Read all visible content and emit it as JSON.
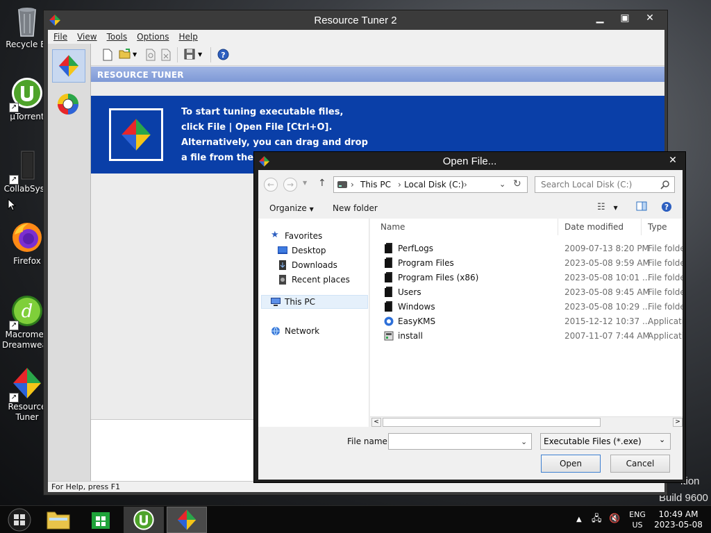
{
  "desktop": {
    "icons": [
      {
        "label": "Recycle Bi",
        "icon": "recycle-bin-icon"
      },
      {
        "label": "µTorrent",
        "icon": "utorrent-icon"
      },
      {
        "label": "CollabSysC",
        "icon": "collabsys-icon"
      },
      {
        "label": "Firefox",
        "icon": "firefox-icon"
      },
      {
        "label": "Macromed",
        "label2": "Dreamweav",
        "icon": "dreamweaver-icon"
      },
      {
        "label": "Resource",
        "label2": "Tuner",
        "icon": "resource-tuner-icon"
      }
    ],
    "edition_text": "ition",
    "build_text": "Build 9600"
  },
  "main_window": {
    "title": "Resource Tuner 2",
    "menu": [
      "File",
      "View",
      "Tools",
      "Options",
      "Help"
    ],
    "header": "RESOURCE TUNER",
    "banner_lines": [
      "To start tuning executable files,",
      "click File | Open File [Ctrl+O].",
      "Alternatively, you can drag and drop",
      "a file from the W"
    ],
    "status": "For Help, press F1"
  },
  "dialog": {
    "title": "Open File...",
    "breadcrumb": [
      "This PC",
      "Local Disk (C:)"
    ],
    "search_placeholder": "Search Local Disk (C:)",
    "organize": "Organize",
    "new_folder": "New folder",
    "nav": {
      "favorites": "Favorites",
      "desktop": "Desktop",
      "downloads": "Downloads",
      "recent": "Recent places",
      "this_pc": "This PC",
      "network": "Network"
    },
    "columns": {
      "name": "Name",
      "date": "Date modified",
      "type": "Type"
    },
    "files": [
      {
        "name": "PerfLogs",
        "date": "2009-07-13 8:20 PM",
        "type": "File folder",
        "kind": "folder"
      },
      {
        "name": "Program Files",
        "date": "2023-05-08 9:59 AM",
        "type": "File folder",
        "kind": "folder"
      },
      {
        "name": "Program Files (x86)",
        "date": "2023-05-08 10:01 ...",
        "type": "File folder",
        "kind": "folder"
      },
      {
        "name": "Users",
        "date": "2023-05-08 9:45 AM",
        "type": "File folder",
        "kind": "folder"
      },
      {
        "name": "Windows",
        "date": "2023-05-08 10:29 ...",
        "type": "File folder",
        "kind": "folder"
      },
      {
        "name": "EasyKMS",
        "date": "2015-12-12 10:37 ...",
        "type": "Applicatio",
        "kind": "app"
      },
      {
        "name": "install",
        "date": "2007-11-07 7:44 AM",
        "type": "Applicatio",
        "kind": "installer"
      }
    ],
    "file_name_label": "File name:",
    "file_name_value": "",
    "filter": "Executable Files (*.exe)",
    "open": "Open",
    "cancel": "Cancel"
  },
  "taskbar": {
    "lang": "ENG",
    "region": "US",
    "time": "10:49 AM",
    "date": "2023-05-08"
  },
  "colors": {
    "banner_blue": "#0a3fa8",
    "header_blue": "#8aa3dc",
    "window_frame": "#3b3b3b"
  }
}
